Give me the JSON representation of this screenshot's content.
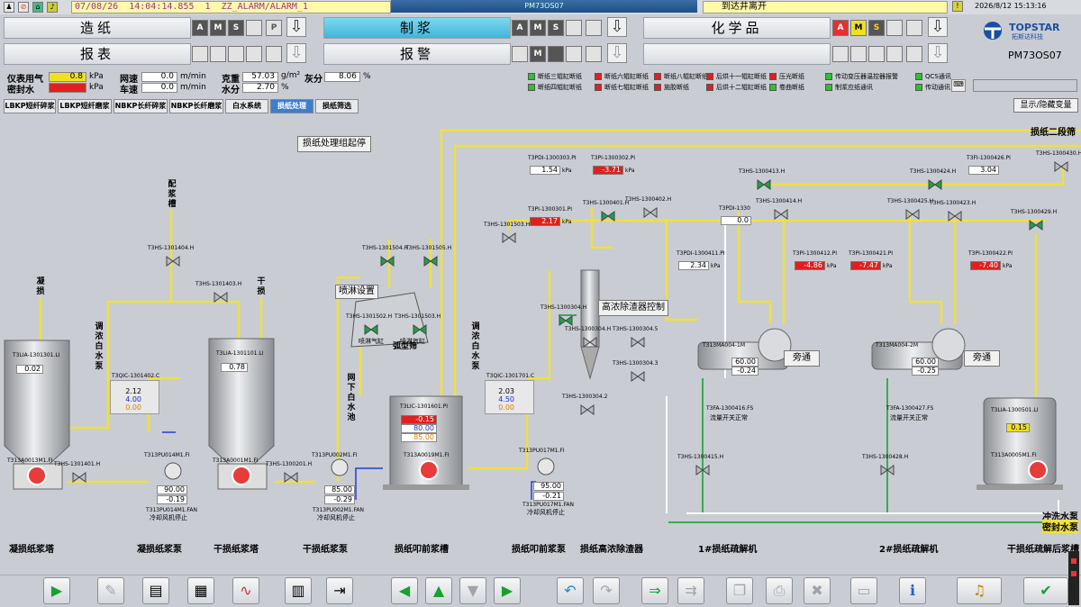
{
  "topbar": {
    "alarm_date": "07/08/26",
    "alarm_time": "14:04:14.855",
    "alarm_count": "1",
    "alarm_tag": "ZZ_ALARM/ALARM_1",
    "window_title": "PM73OS07",
    "alarm2_text": "到达井离开",
    "datetime": "2026/8/12 15:13:16"
  },
  "nav": {
    "row1": [
      "造纸",
      "制浆",
      "化学品"
    ],
    "row2": [
      "报表",
      "报警"
    ],
    "sq_labels": {
      "a": "A",
      "m": "M",
      "s": "S",
      "p": "P"
    }
  },
  "logo": {
    "brand": "TOPSTAR",
    "brand_cn": "拓斯达科技",
    "station": "PM73OS07"
  },
  "params": {
    "instrument_air": {
      "label": "仪表用气",
      "value": "0.8",
      "unit": "kPa"
    },
    "seal_water": {
      "label": "密封水",
      "value": "",
      "unit": "kPa"
    },
    "wire_speed": {
      "label": "网速",
      "value": "0.0",
      "unit": "m/min"
    },
    "car_speed": {
      "label": "车速",
      "value": "0.0",
      "unit": "m/min"
    },
    "basis_weight": {
      "label": "克重",
      "value": "57.03",
      "unit": "g/m²"
    },
    "moisture": {
      "label": "水分",
      "value": "2.70",
      "unit": "%"
    },
    "ash": {
      "label": "灰分",
      "value": "8.06",
      "unit": "%"
    }
  },
  "status_grid": [
    {
      "label": "断纸三辊缸断纸",
      "color": "#2fbf2f"
    },
    {
      "label": "断纸六辊缸断纸",
      "color": "#e02020"
    },
    {
      "label": "断纸八辊缸断纸",
      "color": "#e02020"
    },
    {
      "label": "后烘十一辊缸断纸",
      "color": "#e02020"
    },
    {
      "label": "压光断纸",
      "color": "#e02020"
    },
    {
      "label": "传动变压器温控器报警",
      "color": "#2fbf2f"
    },
    {
      "label": "QCS通讯",
      "color": "#2fbf2f"
    },
    {
      "label": "断纸四辊缸断纸",
      "color": "#2fbf2f"
    },
    {
      "label": "断纸七辊缸断纸",
      "color": "#e02020"
    },
    {
      "label": "施胶断纸",
      "color": "#e02020"
    },
    {
      "label": "后烘十二辊缸断纸",
      "color": "#e02020"
    },
    {
      "label": "卷曲断纸",
      "color": "#2fbf2f"
    },
    {
      "label": "制浆应纸通讯",
      "color": "#2fbf2f"
    },
    {
      "label": "传动通讯",
      "color": "#2fbf2f"
    }
  ],
  "tabs": [
    "LBKP短纤碎浆",
    "LBKP短纤磨浆",
    "NBKP长纤碎浆",
    "NBKP长纤磨浆",
    "白水系统",
    "损纸处理",
    "损纸筛选"
  ],
  "show_hide": "显示/隐藏变量",
  "process": {
    "group_start": "损纸处理组起停",
    "spray_setting": "喷淋设置",
    "high_cleaner_ctrl": "高浓除渣器控制",
    "bypass1": "旁通",
    "bypass2": "旁通",
    "top_line_label": "损纸二段筛",
    "flush_water": "冲洗水泵",
    "seal_water": "密封水泵",
    "vertical_labels": [
      "配浆槽",
      "凝损",
      "调浓白水泵",
      "干损",
      "网下白水池",
      "调浓白水泵"
    ],
    "bottom_labels": [
      "凝损纸浆塔",
      "凝损纸浆泵",
      "干损纸浆塔",
      "干损纸浆泵",
      "损纸叩前浆槽",
      "损纸叩前浆泵",
      "损纸高浓除渣器",
      "1#损纸疏解机",
      "2#损纸疏解机",
      "干损纸疏解后浆槽"
    ],
    "tank1": {
      "tag": "T3LIA-1301301.LI",
      "value": "0.02",
      "motor": "T313A0013M1.FI"
    },
    "tank2": {
      "tag": "T3LIA-1301101.LI",
      "value": "0.78",
      "motor": "T313A0001M1.FI"
    },
    "tank3": {
      "tag": "T3LIC-1301601.PI",
      "value": "-0.15",
      "sp": "80.00",
      "out": "85.00",
      "motor": "T313A0019M1.FI"
    },
    "tank4": {
      "tag": "T3LIA-1300501.LI",
      "value": "0.15",
      "motor": "T313A0005M1.FI"
    },
    "ctrl1": {
      "tag": "T3QIC-1301402.C",
      "pv": "2.12",
      "sp": "4.00",
      "out": "0.00"
    },
    "ctrl2": {
      "tag": "T3QIC-1301701.C",
      "pv": "2.03",
      "sp": "4.50",
      "out": "0.00"
    },
    "pump1": {
      "tag": "T313PU014M1.FI",
      "speed": "90.00",
      "cur": "-0.19",
      "fan": "T313PU014M1.FAN",
      "fan_txt": "冷却风机停止"
    },
    "pump2": {
      "tag": "T313PU002M1.FI",
      "speed": "85.00",
      "cur": "-0.29",
      "fan": "T313PU002M1.FAN",
      "fan_txt": "冷却风机停止"
    },
    "pump3": {
      "tag": "T313PU017M1.FI",
      "speed": "95.00",
      "cur": "-0.21",
      "fan": "T313PU017M1.FAN",
      "fan_txt": "冷却风机停止"
    },
    "refiner1": {
      "tag": "T313MA004-1M",
      "val1": "60.00",
      "val2": "-0.24",
      "flow_tag": "T3FA-1300416.FS",
      "flow_txt": "流量开关正常"
    },
    "refiner2": {
      "tag": "T313MA004-2M",
      "val1": "60.00",
      "val2": "-0.25",
      "flow_tag": "T3FA-1300427.FS",
      "flow_txt": "流量开关正常"
    },
    "pi_values": [
      {
        "tag": "T3PDI-1300303.PI",
        "value": "1.54",
        "unit": "kPa",
        "alarm": false
      },
      {
        "tag": "T3PI-1300302.PI",
        "value": "-3.71",
        "unit": "kPa",
        "alarm": true
      },
      {
        "tag": "T3PI-1300301.PI",
        "value": "2.17",
        "unit": "kPa",
        "alarm": true
      },
      {
        "tag": "T3PDI-1300411.PI",
        "value": "2.34",
        "unit": "kPa",
        "alarm": false
      },
      {
        "tag": "T3PI-1300412.PI",
        "value": "-4.86",
        "unit": "kPa",
        "alarm": true
      },
      {
        "tag": "T3PI-1300421.PI",
        "value": "-7.47",
        "unit": "kPa",
        "alarm": true
      },
      {
        "tag": "T3PI-1300422.PI",
        "value": "-7.40",
        "unit": "kPa",
        "alarm": true
      },
      {
        "tag": "T3FI-1300426.PI",
        "value": "3.04",
        "unit": "",
        "alarm": false
      },
      {
        "tag": "T3PDI-1330",
        "value": "0.0",
        "unit": "",
        "alarm": false
      }
    ],
    "valve_tags": [
      "T3HS-1301404.H",
      "T3HS-1301403.H",
      "T3HS-1301401.H",
      "T3HS-1300201.H",
      "T3HS-1301504.H",
      "T3HS-1301505.H",
      "T3HS-1301502.H",
      "T3HS-1301503.H",
      "T3HS-1301503.H",
      "T3HS-1300401.H",
      "T3HS-1300402.H",
      "T3HS-1300304.H",
      "T3HS-1300304.H",
      "T3HS-1300304.5",
      "T3HS-1300304.3",
      "T3HS-1300304.2",
      "T3HS-1300413.H",
      "T3HS-1300414.H",
      "T3HS-1300424.H",
      "T3HS-1300423.H",
      "T3HS-1300425.H",
      "T3HS-1300430.H",
      "T3HS-1300429.H",
      "T3HS-1300415.H",
      "T3HS-1300428.H"
    ],
    "spray_valves": [
      "喷淋气缸",
      "喷淋气缸"
    ],
    "arc_screen": "弧型筛"
  },
  "toolbar_icons": [
    "play-icon",
    "wrench-icon",
    "notepad-icon",
    "clipboard-icon",
    "trend-icon",
    "document-icon",
    "export-icon",
    "left-arrow-icon",
    "up-arrow-icon",
    "down-arrow-icon",
    "right-arrow-icon",
    "undo-icon",
    "redo-icon",
    "transfer-icon",
    "forward-icon",
    "copy-icon",
    "print-icon",
    "close-doc-icon",
    "screen-icon",
    "info-icon",
    "sound-icon",
    "check-all-icon"
  ]
}
